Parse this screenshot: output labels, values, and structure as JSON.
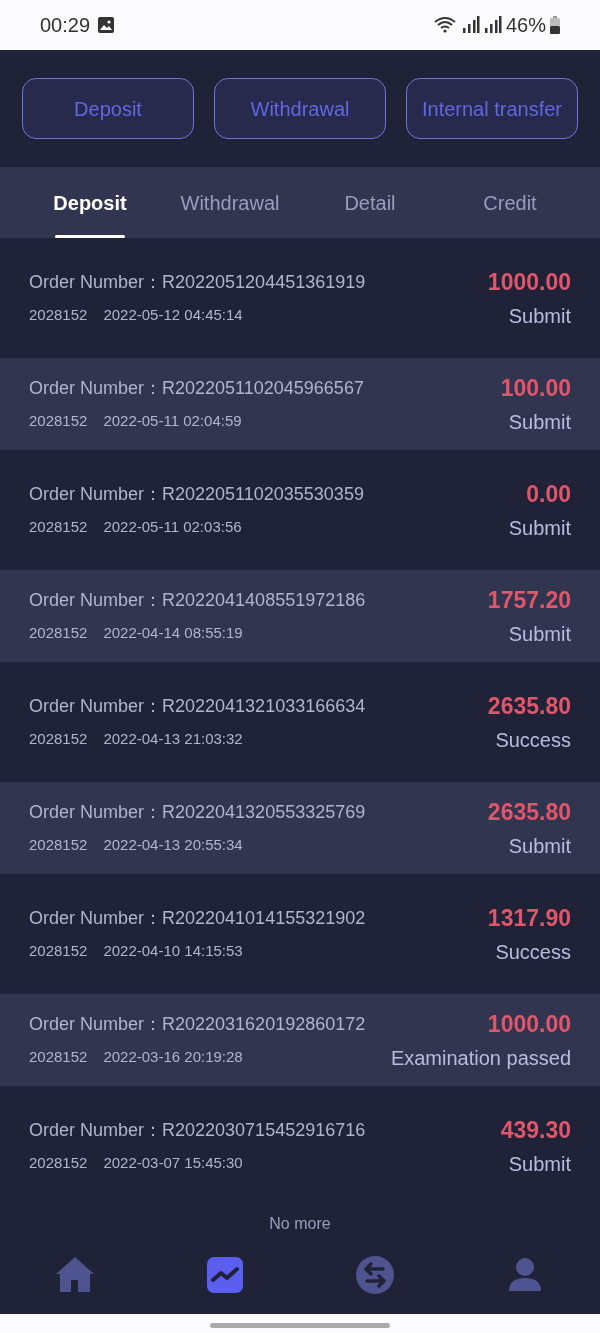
{
  "status_bar": {
    "time": "00:29",
    "battery": "46%"
  },
  "actions": [
    "Deposit",
    "Withdrawal",
    "Internal transfer"
  ],
  "tabs": [
    {
      "label": "Deposit",
      "selected": true
    },
    {
      "label": "Withdrawal",
      "selected": false
    },
    {
      "label": "Detail",
      "selected": false
    },
    {
      "label": "Credit",
      "selected": false
    }
  ],
  "orders": [
    {
      "label": "Order Number：",
      "number": "R2022051204451361919",
      "user": "2028152",
      "time": "2022-05-12 04:45:14",
      "amount": "1000.00",
      "status": "Submit"
    },
    {
      "label": "Order Number：",
      "number": "R2022051102045966567",
      "user": "2028152",
      "time": "2022-05-11 02:04:59",
      "amount": "100.00",
      "status": "Submit"
    },
    {
      "label": "Order Number：",
      "number": "R2022051102035530359",
      "user": "2028152",
      "time": "2022-05-11 02:03:56",
      "amount": "0.00",
      "status": "Submit"
    },
    {
      "label": "Order Number：",
      "number": "R2022041408551972186",
      "user": "2028152",
      "time": "2022-04-14 08:55:19",
      "amount": "1757.20",
      "status": "Submit"
    },
    {
      "label": "Order Number：",
      "number": "R2022041321033166634",
      "user": "2028152",
      "time": "2022-04-13 21:03:32",
      "amount": "2635.80",
      "status": "Success"
    },
    {
      "label": "Order Number：",
      "number": "R2022041320553325769",
      "user": "2028152",
      "time": "2022-04-13 20:55:34",
      "amount": "2635.80",
      "status": "Submit"
    },
    {
      "label": "Order Number：",
      "number": "R2022041014155321902",
      "user": "2028152",
      "time": "2022-04-10 14:15:53",
      "amount": "1317.90",
      "status": "Success"
    },
    {
      "label": "Order Number：",
      "number": "R2022031620192860172",
      "user": "2028152",
      "time": "2022-03-16 20:19:28",
      "amount": "1000.00",
      "status": "Examination passed"
    },
    {
      "label": "Order Number：",
      "number": "R2022030715452916716",
      "user": "2028152",
      "time": "2022-03-07 15:45:30",
      "amount": "439.30",
      "status": "Submit"
    }
  ],
  "footer": "No more",
  "nav": [
    {
      "kind": "home",
      "selected": false
    },
    {
      "kind": "chart",
      "selected": true
    },
    {
      "kind": "exchange",
      "selected": false
    },
    {
      "kind": "profile",
      "selected": false
    }
  ]
}
